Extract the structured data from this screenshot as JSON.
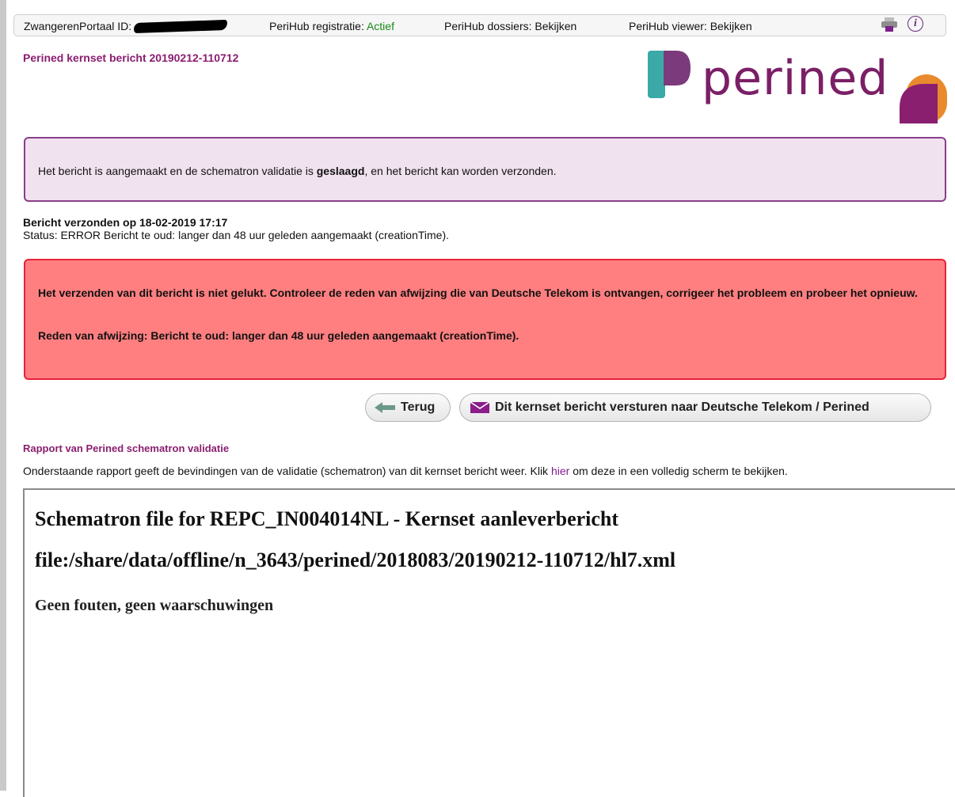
{
  "topbar": {
    "portal_id_label": "ZwangerenPortaal ID:",
    "registration_label": "PeriHub registratie:",
    "registration_value": "Actief",
    "dossiers_label": "PeriHub dossiers:",
    "dossiers_link": "Bekijken",
    "viewer_label": "PeriHub viewer:",
    "viewer_link": "Bekijken",
    "icons": [
      "printer-icon",
      "info-icon"
    ],
    "info_glyph": "i"
  },
  "message": {
    "title": "Perined kernset bericht 20190212-110712"
  },
  "logo": {
    "word": "perined"
  },
  "success_notice": {
    "prefix": "Het bericht is aangemaakt en de schematron validatie is ",
    "emphasis": "geslaagd",
    "suffix": ", en het bericht kan worden verzonden."
  },
  "sent_info": {
    "title": "Bericht verzonden op 18-02-2019 17:17",
    "status": "Status: ERROR Bericht te oud: langer dan 48 uur geleden aangemaakt (creationTime)."
  },
  "error_notice": {
    "paragraph": "Het verzenden van dit bericht is niet gelukt. Controleer de reden van afwijzing die van Deutsche Telekom is ontvangen, corrigeer het probleem en probeer het opnieuw.",
    "reason": "Reden van afwijzing: Bericht te oud: langer dan 48 uur geleden aangemaakt (creationTime)."
  },
  "buttons": {
    "back_label": "Terug",
    "send_label": "Dit kernset bericht versturen naar Deutsche Telekom / Perined"
  },
  "report": {
    "title": "Rapport van Perined schematron validatie",
    "desc_prefix": "Onderstaande rapport geeft de bevindingen van de validatie (schematron) van dit kernset bericht weer. Klik ",
    "desc_link": "hier",
    "desc_suffix": " om deze in een volledig scherm te bekijken.",
    "heading1": "Schematron file for REPC_IN004014NL - Kernset aanleverbericht",
    "heading2": "file:/share/data/offline/n_3643/perined/2018083/20190212-110712/hl7.xml",
    "result": "Geen fouten, geen waarschuwingen"
  },
  "colors": {
    "brand_purple": "#7b1f66",
    "logo_teal": "#3aa9a8",
    "logo_orange": "#e98a2e",
    "success_bg": "#f0e2ef",
    "error_bg": "#ff7f80",
    "error_border": "#e8213a",
    "active_green": "#1a8a1a"
  }
}
